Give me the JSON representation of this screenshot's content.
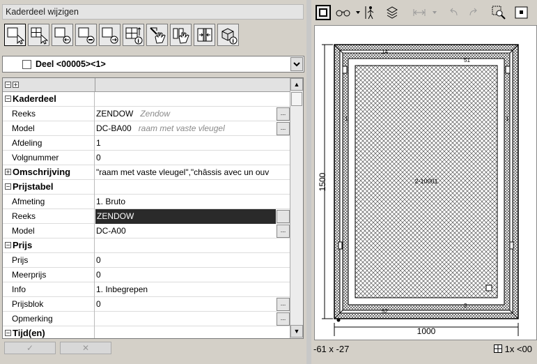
{
  "window": {
    "title": "Kaderdeel wijzigen"
  },
  "part_selector": {
    "value": "Deel <00005><1>"
  },
  "tree_toggles": {
    "collapse": "−",
    "expand": "+"
  },
  "properties": [
    {
      "type": "group",
      "label": "Kaderdeel",
      "state": "−"
    },
    {
      "type": "prop",
      "label": "Reeks",
      "value": "ZENDOW",
      "hint": "Zendow",
      "button": "..."
    },
    {
      "type": "prop",
      "label": "Model",
      "value": "DC-BA00",
      "hint": "raam met vaste vleugel",
      "button": "..."
    },
    {
      "type": "prop",
      "label": "Afdeling",
      "value": "1"
    },
    {
      "type": "prop",
      "label": "Volgnummer",
      "value": "0"
    },
    {
      "type": "group",
      "label": "Omschrijving",
      "state": "+",
      "value": "\"raam met vaste vleugel\",\"châssis avec un ouv"
    },
    {
      "type": "group",
      "label": "Prijstabel",
      "state": "−"
    },
    {
      "type": "prop",
      "label": "Afmeting",
      "value": "1. Bruto"
    },
    {
      "type": "prop",
      "label": "Reeks",
      "value": "ZENDOW",
      "selected": true,
      "button": ""
    },
    {
      "type": "prop",
      "label": "Model",
      "value": "DC-A00",
      "button": "..."
    },
    {
      "type": "group",
      "label": "Prijs",
      "state": "−"
    },
    {
      "type": "prop",
      "label": "Prijs",
      "value": "0"
    },
    {
      "type": "prop",
      "label": "Meerprijs",
      "value": "0"
    },
    {
      "type": "prop",
      "label": "Info",
      "value": "1. Inbegrepen"
    },
    {
      "type": "prop",
      "label": "Prijsblok",
      "value": "0",
      "button": "..."
    },
    {
      "type": "prop",
      "label": "Opmerking",
      "value": "",
      "button": "..."
    },
    {
      "type": "group",
      "label": "Tijd(en)",
      "state": "−"
    }
  ],
  "footer": {
    "ok_glyph": "✓",
    "cancel_glyph": "✕"
  },
  "drawing": {
    "width_dim": "1000",
    "height_dim": "1500",
    "center_label": "2-10001",
    "tag_14": "14",
    "tag_52": "52",
    "tag_51": "51",
    "tag_1_left": "1",
    "tag_1_right": "1",
    "tag_2": "2"
  },
  "status": {
    "coords": "-61 x -27",
    "zoom": "1x <00"
  }
}
